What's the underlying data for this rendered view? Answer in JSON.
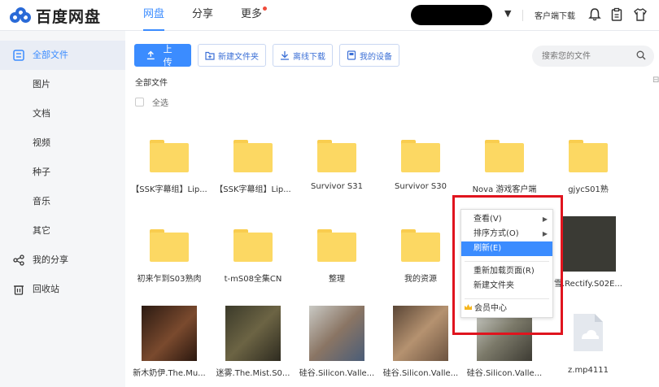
{
  "header": {
    "logo_text": "百度网盘",
    "nav": [
      {
        "label": "网盘",
        "active": true
      },
      {
        "label": "分享",
        "active": false
      },
      {
        "label": "更多",
        "active": false,
        "dot": true
      }
    ],
    "client_download": "客户端下载",
    "icons": [
      "bell-icon",
      "clipboard-icon",
      "shirt-icon"
    ]
  },
  "sidebar": {
    "items": [
      {
        "label": "全部文件",
        "icon": "files-icon",
        "active": true
      },
      {
        "label": "图片"
      },
      {
        "label": "文档"
      },
      {
        "label": "视频"
      },
      {
        "label": "种子"
      },
      {
        "label": "音乐"
      },
      {
        "label": "其它"
      },
      {
        "label": "我的分享",
        "icon": "share-icon"
      },
      {
        "label": "回收站",
        "icon": "trash-icon"
      }
    ]
  },
  "toolbar": {
    "upload": "上传",
    "new_folder": "新建文件夹",
    "offline_download": "离线下载",
    "my_devices": "我的设备"
  },
  "search": {
    "placeholder": "搜索您的文件"
  },
  "breadcrumb": "全部文件",
  "select_all": "全选",
  "files_row1": [
    {
      "label": "【SSK字幕组】Lip..."
    },
    {
      "label": "【SSK字幕组】Lip..."
    },
    {
      "label": "Survivor S31"
    },
    {
      "label": "Survivor S30"
    },
    {
      "label": "Nova 游戏客户端"
    },
    {
      "label": "gjycS01熟"
    }
  ],
  "files_row2": [
    {
      "label": "初来乍到S03熟肉"
    },
    {
      "label": "t-mS08全集CN"
    },
    {
      "label": "整理"
    },
    {
      "label": "我的资源"
    },
    {
      "label": "雪.Rectify.S02E..."
    }
  ],
  "files_row3": [
    {
      "label": "新木奶伊.The.Mu..."
    },
    {
      "label": "迷雾.The.Mist.S0..."
    },
    {
      "label": "硅谷.Silicon.Valle..."
    },
    {
      "label": "硅谷.Silicon.Valle..."
    },
    {
      "label": "硅谷.Silicon.Valle..."
    },
    {
      "label": "z.mp4111"
    }
  ],
  "context_menu": {
    "view": "查看(V)",
    "sort": "排序方式(O)",
    "refresh": "刷新(E)",
    "reload": "重新加载页面(R)",
    "new_folder": "新建文件夹",
    "vip": "会员中心"
  },
  "colors": {
    "accent": "#3b8cff",
    "folder": "#fcd863",
    "highlight_box": "#e0141e"
  }
}
